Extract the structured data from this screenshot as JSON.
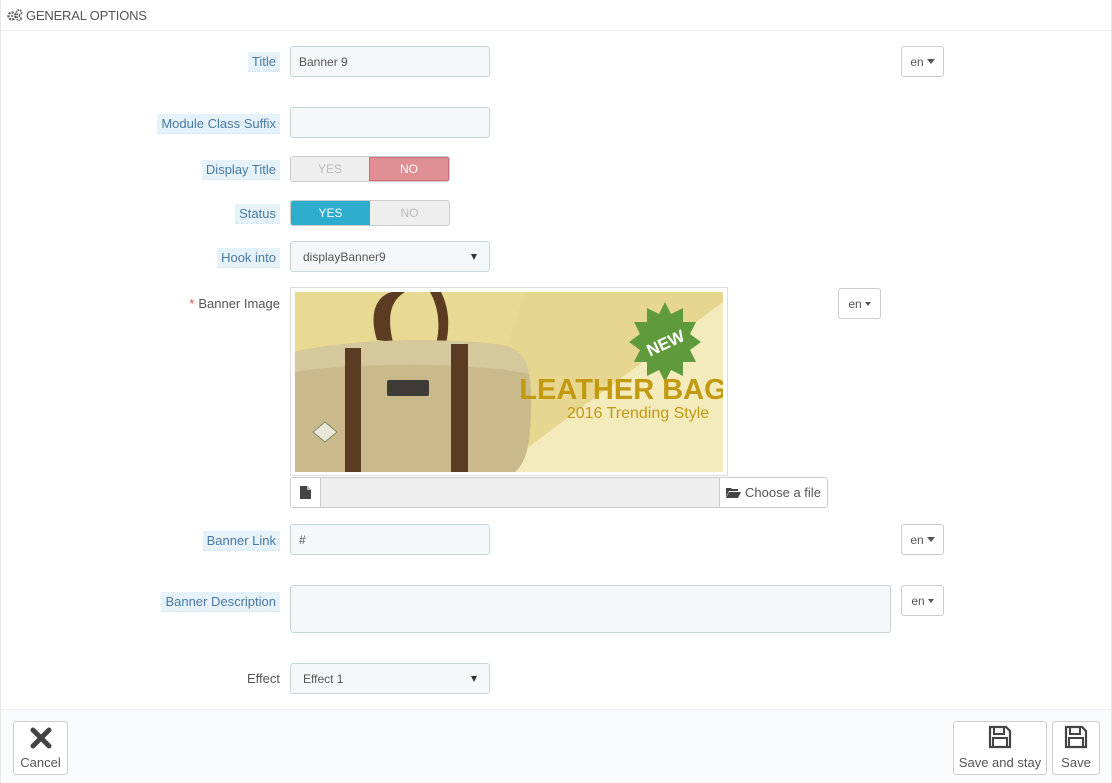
{
  "panel": {
    "heading": "GENERAL OPTIONS"
  },
  "fields": {
    "title": {
      "label": "Title",
      "value": "Banner 9",
      "lang": "en"
    },
    "module_class_suffix": {
      "label": "Module Class Suffix",
      "value": ""
    },
    "display_title": {
      "label": "Display Title",
      "yes": "YES",
      "no": "NO",
      "selected": "NO"
    },
    "status": {
      "label": "Status",
      "yes": "YES",
      "no": "NO",
      "selected": "YES"
    },
    "hook_into": {
      "label": "Hook into",
      "value": "displayBanner9"
    },
    "banner_image": {
      "label": "Banner Image",
      "required": "*",
      "lang": "en",
      "choose_file": "Choose a file",
      "preview": {
        "headline": "LEATHER BAG",
        "subline": "2016 Trending Style",
        "badge": "NEW"
      }
    },
    "banner_link": {
      "label": "Banner Link",
      "value": "#",
      "lang": "en"
    },
    "banner_description": {
      "label": "Banner Description",
      "value": "",
      "lang": "en"
    },
    "effect": {
      "label": "Effect",
      "value": "Effect 1"
    }
  },
  "footer": {
    "cancel": "Cancel",
    "save_and_stay": "Save and stay",
    "save": "Save"
  },
  "icons": {
    "heading": "cogs-icon",
    "file": "file-icon",
    "folder": "folder-open-icon",
    "cancel": "close-icon",
    "save": "floppy-disk-icon"
  }
}
